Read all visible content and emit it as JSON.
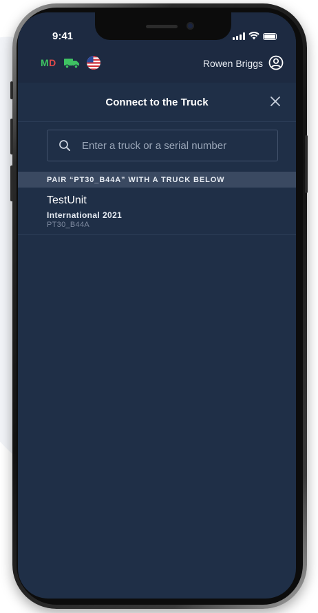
{
  "status_bar": {
    "time": "9:41"
  },
  "app_header": {
    "status_letter_1": "M",
    "status_letter_2": "D",
    "user_name": "Rowen Briggs",
    "icons": [
      "truck-icon",
      "us-flag-icon",
      "user-account-icon"
    ]
  },
  "sheet": {
    "title": "Connect to the Truck",
    "close_icon": "close-icon"
  },
  "search": {
    "placeholder": "Enter a truck or a serial number",
    "value": ""
  },
  "pair_section": {
    "header": "PAIR “PT30_B44A” WITH A TRUCK BELOW"
  },
  "trucks": [
    {
      "name": "TestUnit",
      "model": "International 2021",
      "serial": "PT30_B44A"
    }
  ],
  "colors": {
    "screen_bg": "#1f2f47",
    "header_bg": "#1d2a41",
    "section_bg": "#3a4961",
    "md_green": "#3ec262",
    "md_red": "#e04a4a"
  }
}
